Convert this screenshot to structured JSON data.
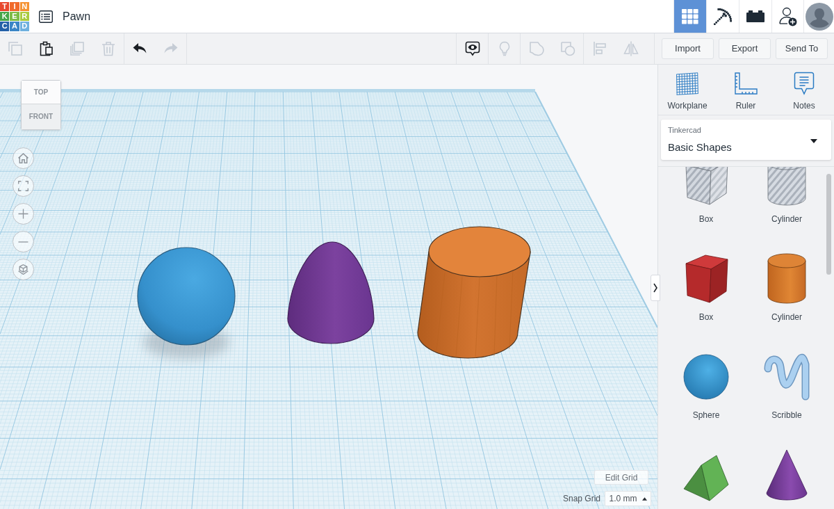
{
  "header": {
    "logo": [
      {
        "letter": "T",
        "color": "#e8472c"
      },
      {
        "letter": "I",
        "color": "#f06a2c"
      },
      {
        "letter": "N",
        "color": "#f59332"
      },
      {
        "letter": "K",
        "color": "#46a548"
      },
      {
        "letter": "E",
        "color": "#7dbb45"
      },
      {
        "letter": "R",
        "color": "#aacb3e"
      },
      {
        "letter": "C",
        "color": "#2460a8"
      },
      {
        "letter": "A",
        "color": "#3b85c6"
      },
      {
        "letter": "D",
        "color": "#6fb0de"
      }
    ],
    "design_title": "Pawn",
    "view_modes": [
      {
        "kind": "shapes",
        "selected": true
      },
      {
        "kind": "blocks",
        "selected": false
      },
      {
        "kind": "bricks",
        "selected": false
      }
    ]
  },
  "toolbar": {
    "left_groups": [
      [
        {
          "kind": "copy",
          "disabled": true
        },
        {
          "kind": "paste",
          "disabled": false
        },
        {
          "kind": "duplicate",
          "disabled": true
        },
        {
          "kind": "delete",
          "disabled": true
        }
      ],
      [
        {
          "kind": "undo",
          "disabled": false
        },
        {
          "kind": "redo",
          "disabled": true
        }
      ]
    ],
    "right_groups": [
      [
        {
          "kind": "notes_visibility",
          "disabled": false
        }
      ],
      [
        {
          "kind": "light",
          "disabled": true
        }
      ],
      [
        {
          "kind": "group",
          "disabled": true
        },
        {
          "kind": "ungroup",
          "disabled": true
        }
      ],
      [
        {
          "kind": "align",
          "disabled": true
        },
        {
          "kind": "mirror",
          "disabled": true
        }
      ]
    ],
    "buttons": [
      "Import",
      "Export",
      "Send To"
    ]
  },
  "workplane": {
    "view_cube": {
      "top": "TOP",
      "front": "FRONT"
    },
    "objects": [
      {
        "kind": "sphere"
      },
      {
        "kind": "paraboloid"
      },
      {
        "kind": "cylinder"
      }
    ],
    "edit_grid": "Edit Grid",
    "snap_grid": {
      "label": "Snap Grid",
      "value": "1.0 mm"
    }
  },
  "panel": {
    "tools": [
      {
        "kind": "workplane",
        "label": "Workplane"
      },
      {
        "kind": "ruler",
        "label": "Ruler"
      },
      {
        "kind": "notes",
        "label": "Notes"
      }
    ],
    "library": {
      "source": "Tinkercad",
      "value": "Basic Shapes"
    },
    "shapes": [
      {
        "kind": "box_hole",
        "label": "Box"
      },
      {
        "kind": "cylinder_hole",
        "label": "Cylinder"
      },
      {
        "kind": "box",
        "label": "Box"
      },
      {
        "kind": "cylinder",
        "label": "Cylinder"
      },
      {
        "kind": "sphere",
        "label": "Sphere"
      },
      {
        "kind": "scribble",
        "label": "Scribble"
      },
      {
        "kind": "roof"
      },
      {
        "kind": "cone"
      }
    ]
  }
}
